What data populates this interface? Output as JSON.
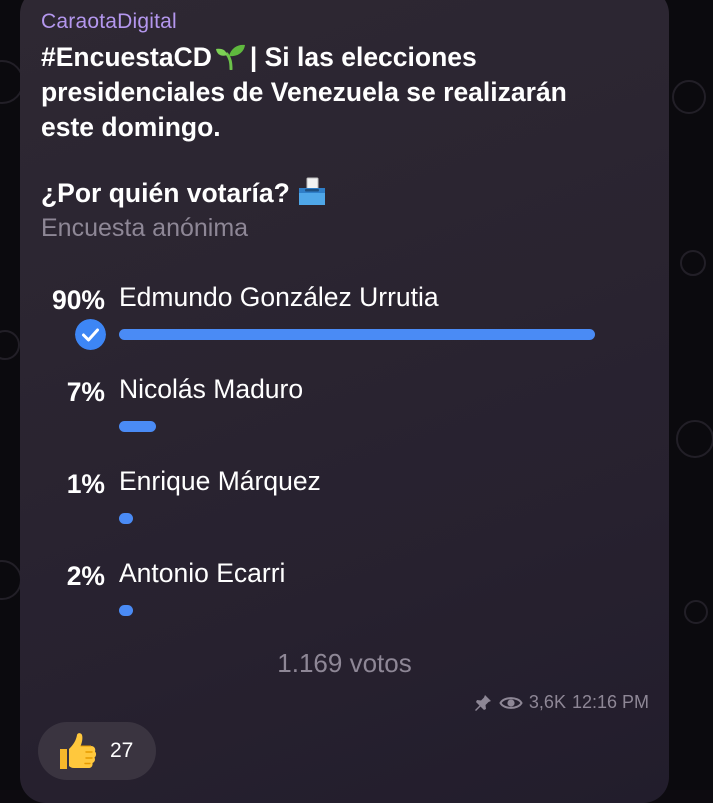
{
  "post": {
    "sender": "CaraotaDigital",
    "message_line1_pre": "#EncuestaCD",
    "message_line1_post": "| Si las elecciones",
    "message_line2": "presidenciales de Venezuela se realizarán",
    "message_line3": "este domingo."
  },
  "poll": {
    "question": "¿Por quién votaría?",
    "type": "Encuesta anónima",
    "options": [
      {
        "label": "Edmundo González Urrutia",
        "percent": "90%",
        "fraction": 0.9,
        "selected": true
      },
      {
        "label": "Nicolás Maduro",
        "percent": "7%",
        "fraction": 0.07,
        "selected": false
      },
      {
        "label": "Enrique Márquez",
        "percent": "1%",
        "fraction": 0.01,
        "selected": false
      },
      {
        "label": "Antonio Ecarri",
        "percent": "2%",
        "fraction": 0.02,
        "selected": false
      }
    ],
    "votes": "1.169 votos"
  },
  "meta": {
    "views": "3,6K",
    "time": "12:16 PM",
    "icons": [
      "pin-icon",
      "eye-icon"
    ]
  },
  "reaction": {
    "icon": "thumbs-up-icon",
    "count": "27"
  },
  "colors": {
    "accent": "#4a8bf5",
    "sender": "#b497ee",
    "muted": "#8e8796"
  }
}
